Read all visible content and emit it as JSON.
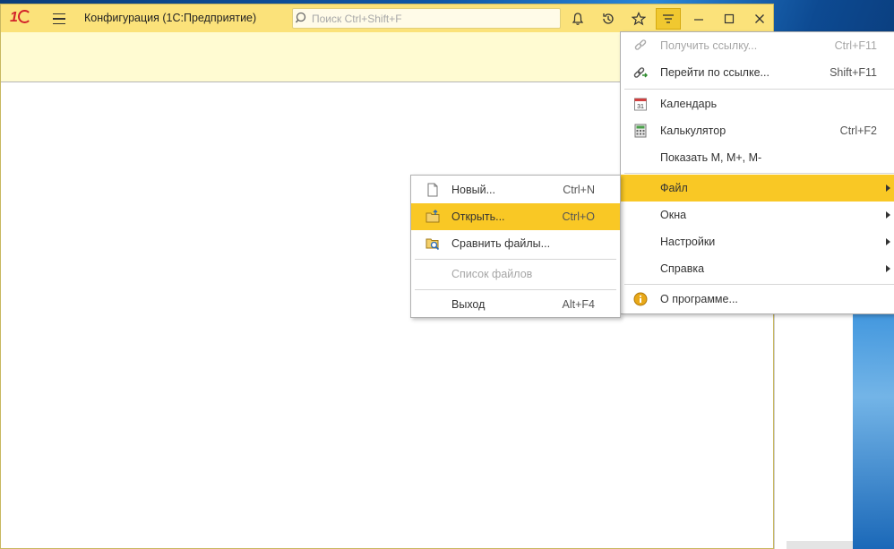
{
  "app": {
    "title": "Конфигурация  (1С:Предприятие)",
    "search_placeholder": "Поиск Ctrl+Shift+F"
  },
  "toolbar": {
    "icons": [
      "bell-icon",
      "history-icon",
      "star-icon",
      "main-menu-icon"
    ],
    "window_controls": [
      "minimize-icon",
      "maximize-icon",
      "close-icon"
    ]
  },
  "main_menu": {
    "items": [
      {
        "label": "Получить ссылку...",
        "shortcut": "Ctrl+F11",
        "icon": "link-icon",
        "disabled": true
      },
      {
        "label": "Перейти по ссылке...",
        "shortcut": "Shift+F11",
        "icon": "goto-link-icon"
      },
      {
        "label": "Календарь",
        "shortcut": "",
        "icon": "calendar-icon",
        "icon_text": "31"
      },
      {
        "label": "Калькулятор",
        "shortcut": "Ctrl+F2",
        "icon": "calculator-icon"
      },
      {
        "label": "Показать M, M+, M-",
        "shortcut": ""
      },
      {
        "label": "Файл",
        "submenu": true,
        "highlighted": true
      },
      {
        "label": "Окна",
        "submenu": true
      },
      {
        "label": "Настройки",
        "submenu": true
      },
      {
        "label": "Справка",
        "submenu": true
      },
      {
        "label": "О программе...",
        "icon": "info-icon"
      }
    ]
  },
  "file_menu": {
    "items": [
      {
        "label": "Новый...",
        "shortcut": "Ctrl+N",
        "icon": "new-document-icon"
      },
      {
        "label": "Открыть...",
        "shortcut": "Ctrl+O",
        "icon": "open-folder-icon",
        "highlighted": true
      },
      {
        "label": "Сравнить файлы...",
        "shortcut": "",
        "icon": "compare-files-icon"
      },
      {
        "label": "Список файлов",
        "shortcut": "",
        "disabled": true
      },
      {
        "label": "Выход",
        "shortcut": "Alt+F4"
      }
    ]
  },
  "colors": {
    "titlebar": "#fbe27a",
    "panel": "#fffbd2",
    "highlight": "#f9c825",
    "brand_red": "#d2232a"
  }
}
